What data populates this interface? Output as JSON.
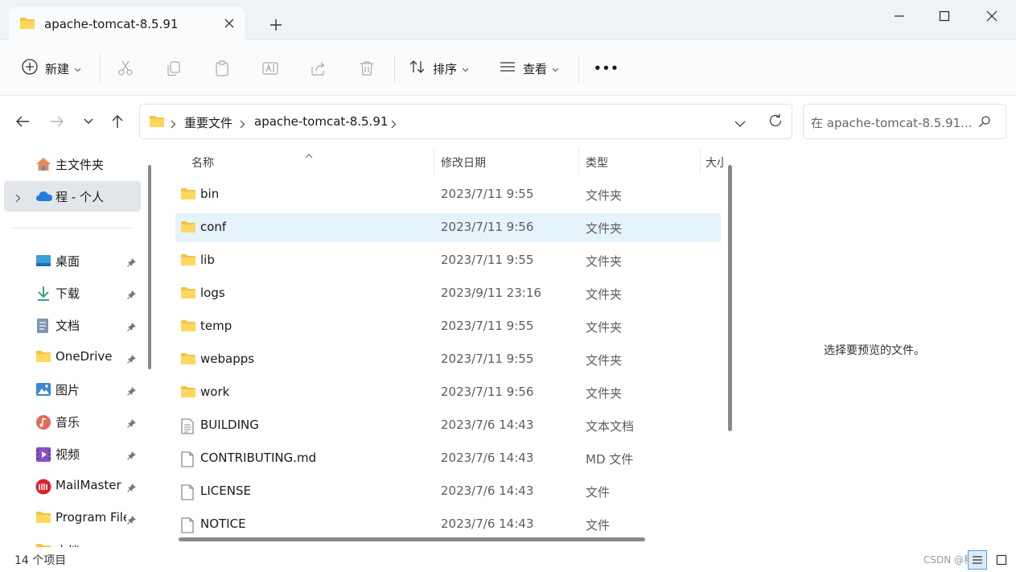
{
  "tab": {
    "title": "apache-tomcat-8.5.91",
    "icon": "folder-icon"
  },
  "window_controls": [
    "minimize",
    "maximize",
    "close"
  ],
  "toolbar": {
    "new_label": "新建",
    "sort_label": "排序",
    "view_label": "查看",
    "more_label": "•••"
  },
  "address": {
    "breadcrumbs": [
      "重要文件",
      "apache-tomcat-8.5.91"
    ],
    "search_placeholder": "在 apache-tomcat-8.5.91..."
  },
  "sidebar": {
    "items": [
      {
        "label": "主文件夹",
        "icon": "home-icon"
      },
      {
        "label": "程 - 个人",
        "icon": "onedrive-cloud-icon"
      },
      {
        "label": "桌面",
        "icon": "desktop-icon"
      },
      {
        "label": "下载",
        "icon": "download-icon"
      },
      {
        "label": "文档",
        "icon": "documents-icon"
      },
      {
        "label": "OneDrive",
        "icon": "folder-icon"
      },
      {
        "label": "图片",
        "icon": "pictures-icon"
      },
      {
        "label": "音乐",
        "icon": "music-icon"
      },
      {
        "label": "视频",
        "icon": "videos-icon"
      },
      {
        "label": "MailMaster",
        "icon": "mailmaster-icon"
      },
      {
        "label": "Program Files",
        "icon": "folder-icon"
      },
      {
        "label": "文档",
        "icon": "folder-icon"
      }
    ]
  },
  "columns": {
    "name": "名称",
    "modified": "修改日期",
    "type": "类型",
    "size": "大小"
  },
  "files": [
    {
      "name": "bin",
      "date": "2023/7/11 9:55",
      "type": "文件夹",
      "kind": "folder"
    },
    {
      "name": "conf",
      "date": "2023/7/11 9:56",
      "type": "文件夹",
      "kind": "folder"
    },
    {
      "name": "lib",
      "date": "2023/7/11 9:55",
      "type": "文件夹",
      "kind": "folder"
    },
    {
      "name": "logs",
      "date": "2023/9/11 23:16",
      "type": "文件夹",
      "kind": "folder"
    },
    {
      "name": "temp",
      "date": "2023/7/11 9:55",
      "type": "文件夹",
      "kind": "folder"
    },
    {
      "name": "webapps",
      "date": "2023/7/11 9:55",
      "type": "文件夹",
      "kind": "folder"
    },
    {
      "name": "work",
      "date": "2023/7/11 9:56",
      "type": "文件夹",
      "kind": "folder"
    },
    {
      "name": "BUILDING",
      "date": "2023/7/6 14:43",
      "type": "文本文档",
      "kind": "text"
    },
    {
      "name": "CONTRIBUTING.md",
      "date": "2023/7/6 14:43",
      "type": "MD 文件",
      "kind": "file"
    },
    {
      "name": "LICENSE",
      "date": "2023/7/6 14:43",
      "type": "文件",
      "kind": "file"
    },
    {
      "name": "NOTICE",
      "date": "2023/7/6 14:43",
      "type": "文件",
      "kind": "file"
    }
  ],
  "preview": {
    "message": "选择要预览的文件。"
  },
  "status": {
    "item_count": "14 个项目"
  },
  "watermark": "CSDN @程"
}
